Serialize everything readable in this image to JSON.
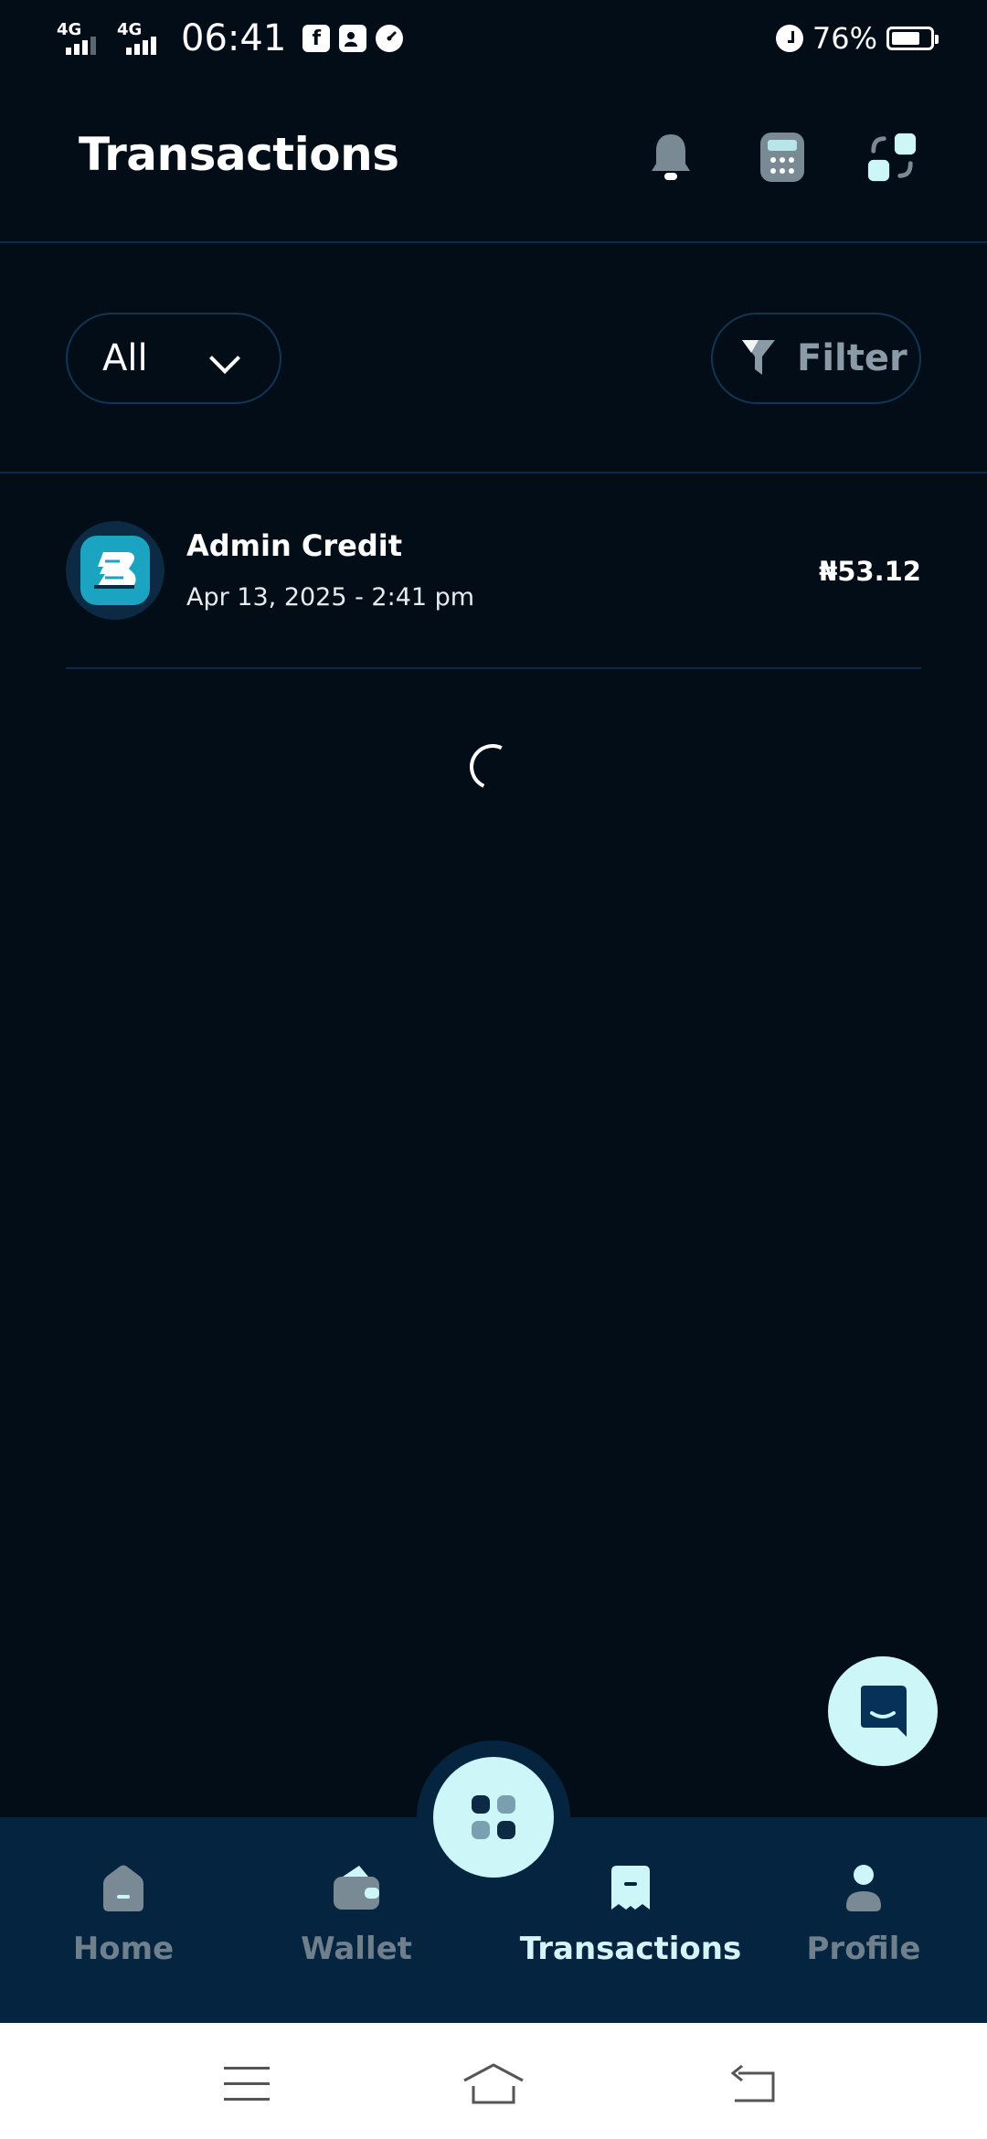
{
  "status_bar": {
    "network_1": "4G",
    "network_2": "4G",
    "time": "06:41",
    "battery_pct": "76%",
    "battery_level": 0.76,
    "notification_icons": [
      "facebook-icon",
      "contact-card-icon",
      "speed-icon"
    ]
  },
  "header": {
    "title": "Transactions",
    "icons": [
      "bell-icon",
      "calculator-icon",
      "apps-grid-icon"
    ]
  },
  "filters": {
    "type_select": "All",
    "filter_label": "Filter"
  },
  "transactions": [
    {
      "title": "Admin Credit",
      "date": "Apr 13, 2025 - 2:41 pm",
      "amount": "₦53.12",
      "logo_letter": "B"
    }
  ],
  "bottom_nav": {
    "items": [
      {
        "label": "Home",
        "icon": "home-icon",
        "active": false
      },
      {
        "label": "Wallet",
        "icon": "wallet-icon",
        "active": false
      },
      {
        "label": "Transactions",
        "icon": "receipt-icon",
        "active": true
      },
      {
        "label": "Profile",
        "icon": "profile-icon",
        "active": false
      }
    ]
  },
  "colors": {
    "background": "#020d17",
    "nav_background": "#042440",
    "accent": "#cdf6f9",
    "logo_teal": "#1ba3c2",
    "muted": "#6f808c"
  }
}
